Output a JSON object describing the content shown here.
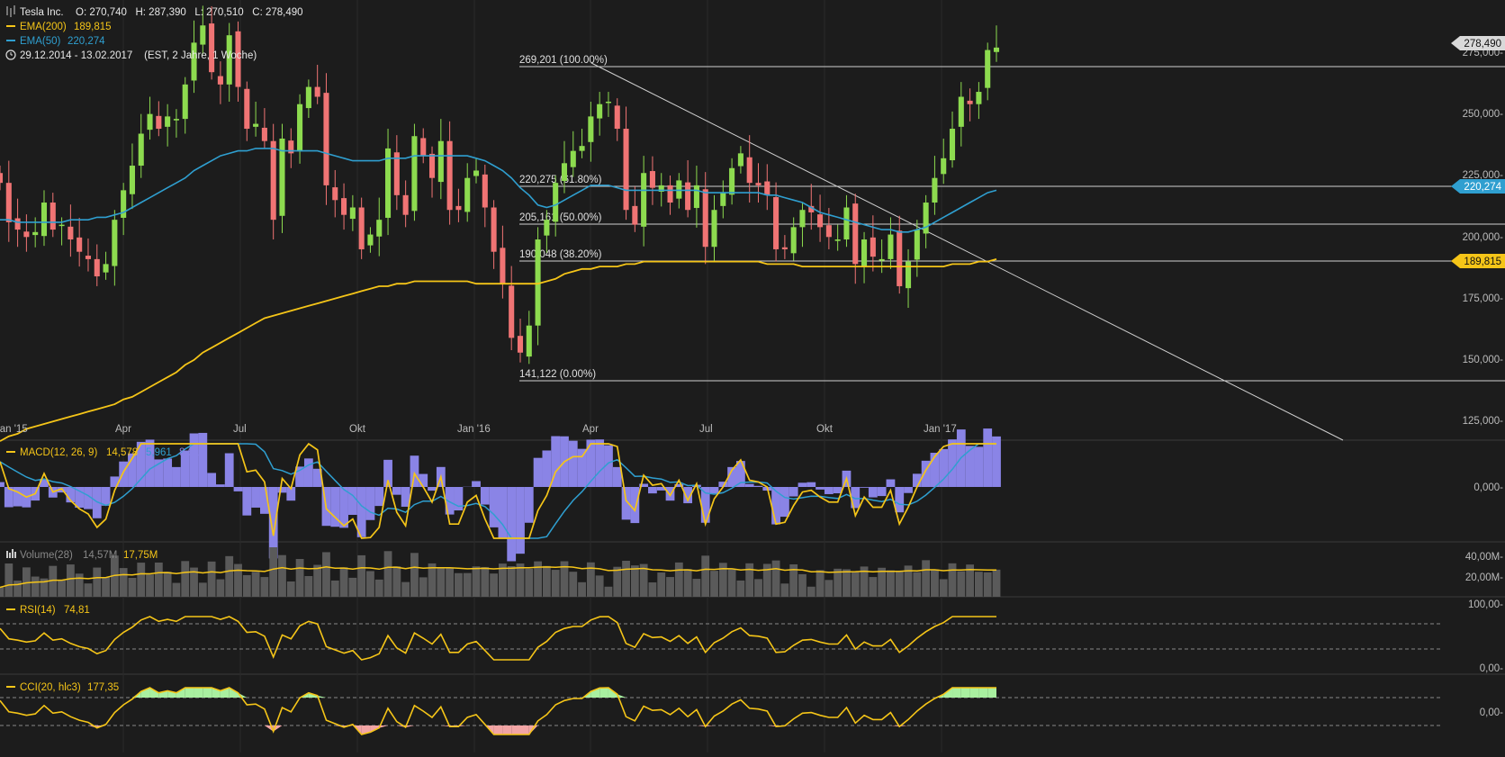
{
  "header": {
    "symbol_icon": "candlestick-icon",
    "instrument": "Tesla Inc.",
    "ohlc": "O: 270,740   H: 287,390   L: 270,510   C: 278,490",
    "ema200_label": "EMA(200)",
    "ema200_value": "189,815",
    "ema50_label": "EMA(50)",
    "ema50_value": "220,274",
    "clock_icon": "clock-icon",
    "range_text": "29.12.2014 - 13.02.2017    (EST, 2 Jahre, 1 Woche)"
  },
  "colors": {
    "background": "#1c1c1c",
    "up": "#8ddb4f",
    "down": "#f07474",
    "ema200": "#f5c518",
    "ema50": "#2f9fd0",
    "macd_hist": "#8a84e6",
    "grid_text": "#bbbbbb"
  },
  "fib_labels": {
    "f100": "269,201 (100.00%)",
    "f618": "220,275 (61.80%)",
    "f50": "205,161 (50.00%)",
    "f382": "190,048 (38.20%)",
    "f0": "141,122 (0.00%)"
  },
  "price_badges": {
    "close": "278,490",
    "ema50": "220,274",
    "ema200": "189,815"
  },
  "price_axis": [
    "275,000-",
    "250,000-",
    "225,000-",
    "200,000-",
    "175,000-",
    "150,000-",
    "125,000-"
  ],
  "time_axis": [
    "Jan '15",
    "Apr",
    "Jul",
    "Okt",
    "Jan '16",
    "Apr",
    "Jul",
    "Okt",
    "Jan '17"
  ],
  "macd": {
    "label": "MACD(12, 26, 9)",
    "v1": "14,578",
    "v2": "5,961",
    "v3": "8,617",
    "axis": "0,000-"
  },
  "volume": {
    "icon": "bar-chart-icon",
    "label": "Volume(28)",
    "v1": "14,57M",
    "v2": "17,75M",
    "axis": [
      "40,00M-",
      "20,00M-"
    ]
  },
  "rsi": {
    "label": "RSI(14)",
    "value": "74,81",
    "axis": [
      "100,00-",
      "0,00-"
    ]
  },
  "cci": {
    "label": "CCI(20, hlc3)",
    "value": "177,35",
    "axis": "0,00-"
  },
  "chart_data": {
    "type": "candlestick",
    "title": "Tesla Inc.",
    "interval": "weekly",
    "ylim": [
      115000,
      290000
    ],
    "fibonacci": [
      {
        "level": "100.00%",
        "value": 269201
      },
      {
        "level": "61.80%",
        "value": 220275
      },
      {
        "level": "50.00%",
        "value": 205161
      },
      {
        "level": "38.20%",
        "value": 190048
      },
      {
        "level": "0.00%",
        "value": 141122
      }
    ],
    "last": {
      "open": 270740,
      "high": 287390,
      "low": 270510,
      "close": 278490
    },
    "closes": [
      223,
      207,
      204,
      201,
      203,
      215,
      204,
      206,
      200,
      195,
      192,
      185,
      190,
      208,
      220,
      230,
      243,
      251,
      245,
      250,
      249,
      263,
      280,
      287,
      268,
      263,
      283,
      262,
      245,
      247,
      240,
      208,
      241,
      235,
      255,
      262,
      258,
      222,
      216,
      210,
      213,
      196,
      202,
      208,
      237,
      218,
      210,
      242,
      234,
      225,
      240,
      212,
      212,
      225,
      228,
      213,
      195,
      182,
      160,
      154,
      165,
      200,
      208,
      223,
      231,
      236,
      238,
      250,
      255,
      256,
      245,
      212,
      206,
      227,
      221,
      222,
      215,
      224,
      212,
      222,
      197,
      212,
      219,
      229,
      235,
      223,
      222,
      218,
      196,
      196,
      205,
      212,
      211,
      205,
      201,
      200,
      213,
      190,
      200,
      193,
      192,
      202,
      181,
      191,
      204,
      215,
      225,
      233,
      245,
      258,
      255,
      260,
      277,
      278
    ],
    "ema200": [
      118,
      120,
      121,
      123,
      124,
      125,
      126,
      127,
      128,
      129,
      130,
      131,
      132,
      133,
      135,
      136,
      138,
      140,
      142,
      144,
      146,
      149,
      151,
      154,
      156,
      158,
      160,
      162,
      164,
      166,
      168,
      169,
      170,
      171,
      172,
      173,
      174,
      175,
      176,
      177,
      178,
      179,
      180,
      181,
      181,
      182,
      182,
      183,
      183,
      183,
      183,
      183,
      183,
      183,
      182,
      182,
      182,
      182,
      182,
      182,
      182,
      182,
      183,
      184,
      186,
      187,
      188,
      188,
      189,
      189,
      189,
      190,
      190,
      191,
      191,
      191,
      191,
      191,
      191,
      191,
      191,
      191,
      191,
      191,
      191,
      191,
      191,
      190,
      190,
      190,
      190,
      189,
      189,
      189,
      189,
      189,
      189,
      189,
      189,
      189,
      189,
      189,
      189,
      189,
      189,
      189,
      189,
      189,
      190,
      190,
      190,
      191,
      191,
      192
    ],
    "ema50": [
      208,
      208,
      207,
      207,
      207,
      207,
      207,
      207,
      208,
      208,
      208,
      209,
      209,
      210,
      211,
      213,
      215,
      217,
      219,
      221,
      223,
      225,
      228,
      230,
      232,
      234,
      235,
      236,
      236,
      237,
      237,
      237,
      236,
      236,
      236,
      236,
      236,
      235,
      234,
      233,
      232,
      232,
      232,
      232,
      233,
      233,
      233,
      234,
      234,
      234,
      234,
      234,
      234,
      234,
      233,
      232,
      230,
      228,
      225,
      221,
      218,
      214,
      213,
      214,
      216,
      218,
      220,
      222,
      222,
      222,
      221,
      220,
      220,
      220,
      220,
      220,
      220,
      220,
      220,
      220,
      219,
      219,
      219,
      219,
      219,
      219,
      219,
      218,
      218,
      217,
      216,
      215,
      213,
      211,
      210,
      209,
      208,
      207,
      206,
      205,
      204,
      204,
      203,
      203,
      204,
      205,
      207,
      209,
      211,
      213,
      215,
      217,
      219,
      220
    ]
  }
}
